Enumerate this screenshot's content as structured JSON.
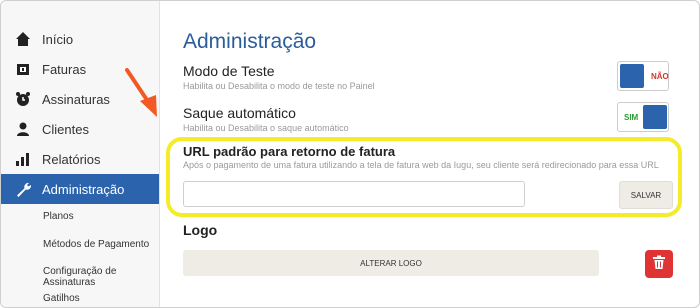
{
  "sidebar": {
    "items": [
      {
        "label": "Início",
        "icon": "home-icon"
      },
      {
        "label": "Faturas",
        "icon": "invoice-icon"
      },
      {
        "label": "Assinaturas",
        "icon": "alarm-clock-icon"
      },
      {
        "label": "Clientes",
        "icon": "user-icon"
      },
      {
        "label": "Relatórios",
        "icon": "bar-chart-icon"
      },
      {
        "label": "Administração",
        "icon": "wrench-icon",
        "active": true
      }
    ],
    "subitems": [
      "Planos",
      "Métodos de Pagamento",
      "Configuração de Assinaturas",
      "Gatilhos"
    ]
  },
  "main": {
    "title": "Administração",
    "test_mode": {
      "title": "Modo de Teste",
      "desc": "Habilita ou Desabilita o modo de teste no Painel",
      "toggle_label": "NÃO",
      "enabled": false
    },
    "auto_withdraw": {
      "title": "Saque automático",
      "desc": "Habilita ou Desabilita o saque automático",
      "toggle_label": "SIM",
      "enabled": true
    },
    "return_url": {
      "title": "URL padrão para retorno de fatura",
      "desc": "Após o pagamento de uma fatura utilizando a tela de fatura web da Iugu, seu cliente será redirecionado para essa URL",
      "value": "",
      "placeholder": "",
      "save_label": "SALVAR"
    },
    "logo": {
      "title": "Logo",
      "change_label": "ALTERAR LOGO",
      "delete_icon": "trash-icon"
    }
  },
  "colors": {
    "accent": "#2b63ac",
    "title": "#2b5d9a",
    "highlight": "#f4ec2a",
    "danger": "#e03434",
    "annotation_arrow": "#f15a24"
  }
}
